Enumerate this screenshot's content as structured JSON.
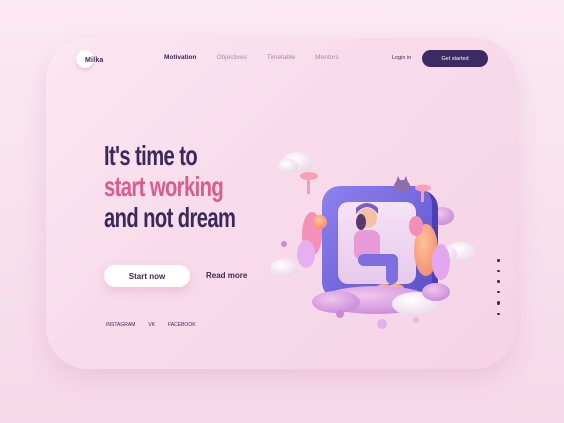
{
  "brand": {
    "name": "Milka"
  },
  "nav": {
    "items": [
      {
        "label": "Motivation",
        "active": true
      },
      {
        "label": "Objectives",
        "active": false
      },
      {
        "label": "Timetable",
        "active": false
      },
      {
        "label": "Mentors",
        "active": false
      }
    ],
    "login_label": "Login in",
    "cta_label": "Get started"
  },
  "hero": {
    "line1": "It's time to",
    "line2": "start working",
    "line3": "and not dream",
    "primary_button": "Start now",
    "secondary_button": "Read more"
  },
  "social": {
    "items": [
      "INSTAGRAM",
      "VK",
      "FACEBOOK"
    ]
  },
  "pagination": {
    "total": 6,
    "active_index": 4
  },
  "colors": {
    "primary_dark": "#3b2a59",
    "accent_pink": "#d95c8e",
    "card_bg": "#fde7f1",
    "button_dark": "#3c2a63"
  },
  "icons": {
    "illustration": "girl-sitting-in-window-3d-illustration"
  }
}
